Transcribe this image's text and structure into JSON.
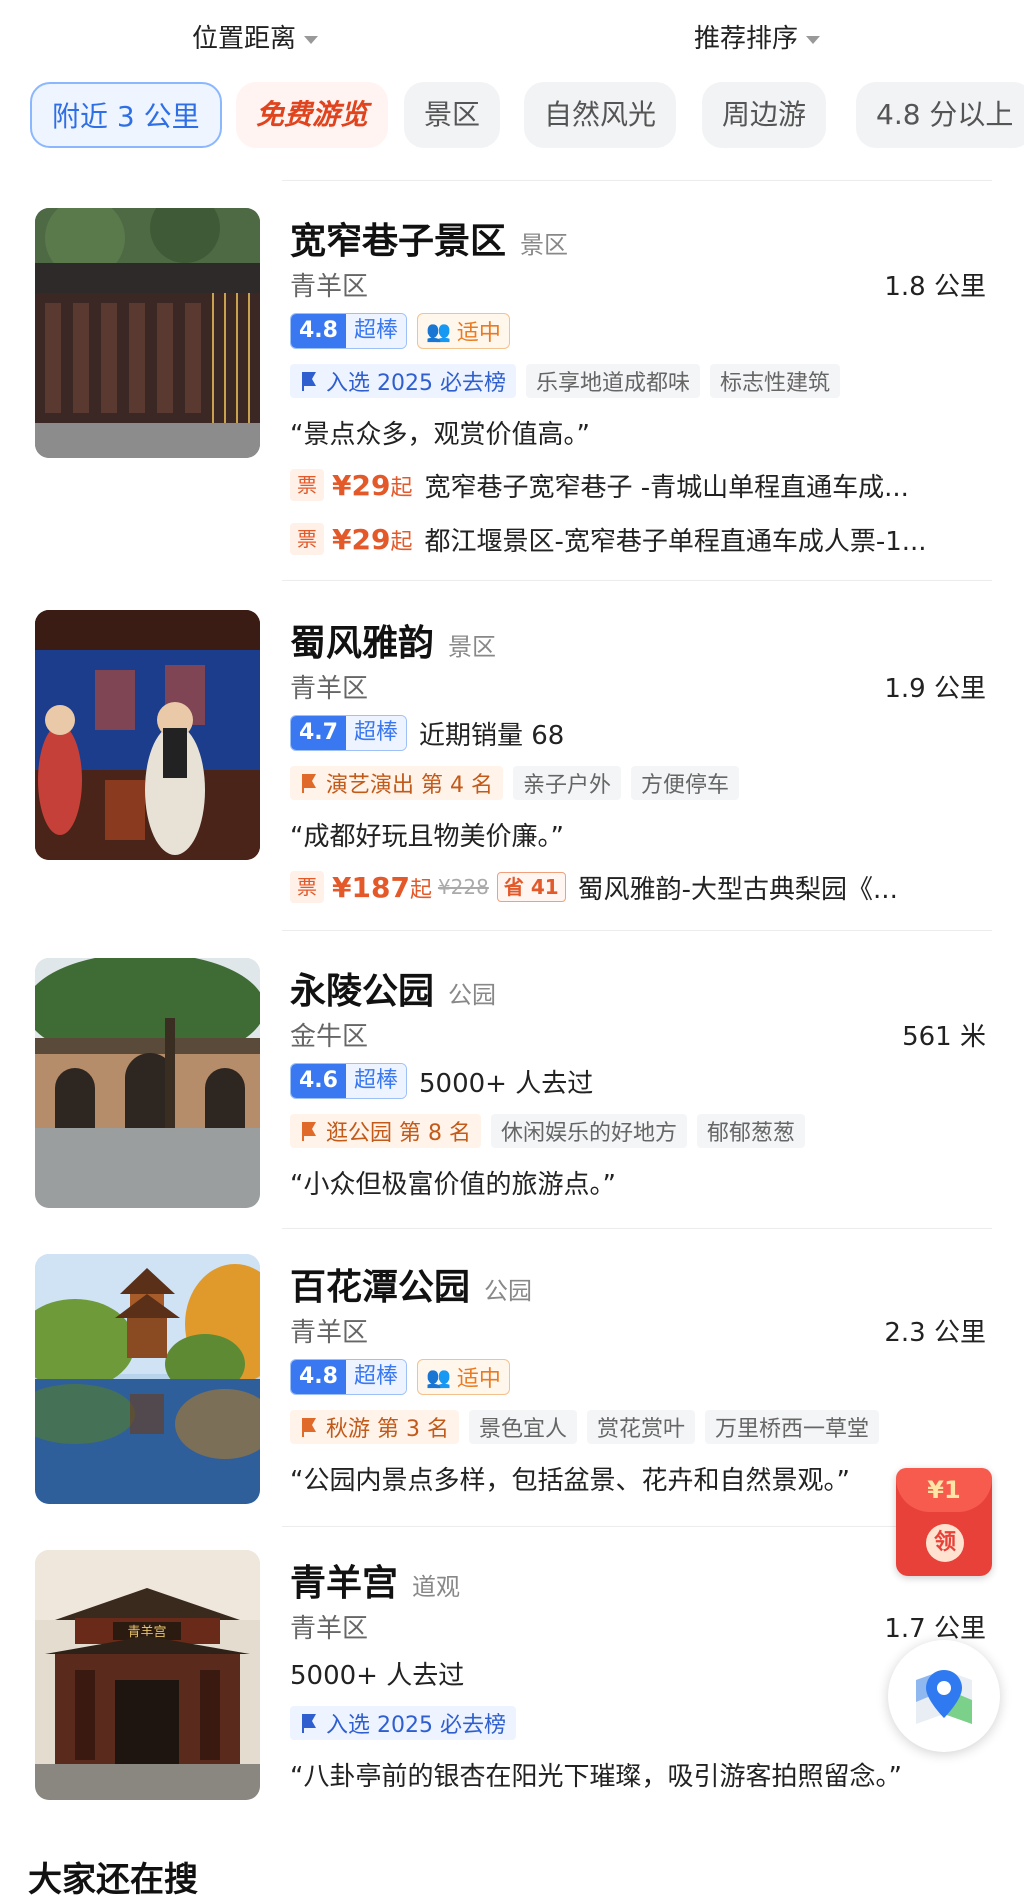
{
  "top_sort": {
    "left_label": "位置距离",
    "right_label": "推荐排序"
  },
  "chips": [
    {
      "label": "附近 3 公里",
      "state": "active"
    },
    {
      "label": "免费游览",
      "state": "highlight"
    },
    {
      "label": "景区",
      "state": "normal"
    },
    {
      "label": "自然风光",
      "state": "normal"
    },
    {
      "label": "周边游",
      "state": "normal"
    },
    {
      "label": "4.8 分以上",
      "state": "normal"
    }
  ],
  "ticket_tag": "票",
  "items": [
    {
      "name": "宽窄巷子景区",
      "category": "景区",
      "district": "青羊区",
      "distance": "1.8 公里",
      "rating": {
        "score": "4.8",
        "label": "超棒"
      },
      "crowd": "适中",
      "tags": [
        {
          "text": "入选 2025 必去榜",
          "type": "rank-blue"
        },
        {
          "text": "乐享地道成都味",
          "type": "normal"
        },
        {
          "text": "标志性建筑",
          "type": "normal"
        }
      ],
      "quote": "“景点众多，观赏价值高。”",
      "tickets": [
        {
          "price": "¥29",
          "suffix": "起",
          "desc": "宽窄巷子宽窄巷子 -青城山单程直通车成..."
        },
        {
          "price": "¥29",
          "suffix": "起",
          "desc": "都江堰景区-宽窄巷子单程直通车成人票-1..."
        }
      ]
    },
    {
      "name": "蜀风雅韵",
      "category": "景区",
      "district": "青羊区",
      "distance": "1.9 公里",
      "rating": {
        "score": "4.7",
        "label": "超棒"
      },
      "extra": "近期销量 68",
      "tags": [
        {
          "text": "演艺演出 第 4 名",
          "type": "rank-orange"
        },
        {
          "text": "亲子户外",
          "type": "normal"
        },
        {
          "text": "方便停车",
          "type": "normal"
        }
      ],
      "quote": "“成都好玩且物美价廉。”",
      "tickets": [
        {
          "price": "¥187",
          "suffix": "起",
          "orig": "¥228",
          "save": "省 41",
          "desc": "蜀风雅韵-大型古典梨园《..."
        }
      ]
    },
    {
      "name": "永陵公园",
      "category": "公园",
      "district": "金牛区",
      "distance": "561 米",
      "rating": {
        "score": "4.6",
        "label": "超棒"
      },
      "extra": "5000+ 人去过",
      "tags": [
        {
          "text": "逛公园 第 8 名",
          "type": "rank-orange"
        },
        {
          "text": "休闲娱乐的好地方",
          "type": "normal"
        },
        {
          "text": "郁郁葱葱",
          "type": "normal"
        }
      ],
      "quote": "“小众但极富价值的旅游点。”"
    },
    {
      "name": "百花潭公园",
      "category": "公园",
      "district": "青羊区",
      "distance": "2.3 公里",
      "rating": {
        "score": "4.8",
        "label": "超棒"
      },
      "crowd": "适中",
      "tags": [
        {
          "text": "秋游 第 3 名",
          "type": "rank-orange"
        },
        {
          "text": "景色宜人",
          "type": "normal"
        },
        {
          "text": "赏花赏叶",
          "type": "normal"
        },
        {
          "text": "万里桥西一草堂",
          "type": "normal"
        }
      ],
      "quote": "“公园内景点多样，包括盆景、花卉和自然景观。”"
    },
    {
      "name": "青羊宫",
      "category": "道观",
      "district": "青羊区",
      "distance": "1.7 公里",
      "extra": "5000+ 人去过",
      "tags": [
        {
          "text": "入选 2025 必去榜",
          "type": "rank-blue"
        }
      ],
      "quote": "“八卦亭前的银杏在阳光下璀璨，吸引游客拍照留念。”",
      "sign_text": "青羊宫"
    }
  ],
  "red_packet": {
    "amount": "¥1",
    "action": "领"
  },
  "section_title": "大家还在搜"
}
